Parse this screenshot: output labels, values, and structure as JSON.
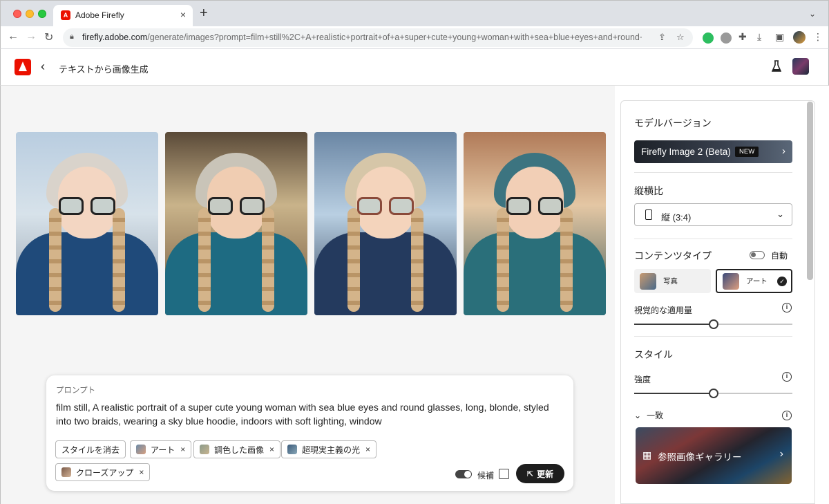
{
  "browser": {
    "tab_title": "Adobe Firefly",
    "url_host": "firefly.adobe.com",
    "url_path": "/generate/images?prompt=film+still%2C+A+realistic+portrait+of+a+super+cute+young+woman+with+sea+blue+eyes+and+round+..."
  },
  "header": {
    "title": "テキストから画像生成"
  },
  "prompt": {
    "label": "プロンプト",
    "text": "film still, A realistic portrait of a super cute young woman with sea blue eyes and round glasses, long, blonde, styled into two braids, wearing a sky blue hoodie, indoors with soft lighting, window",
    "clear_style": "スタイルを消去",
    "chips": [
      "アート",
      "調色した画像",
      "超現実主義の光",
      "クローズアップ"
    ],
    "candidates_label": "候補",
    "update_label": "更新"
  },
  "panel": {
    "model_title": "モデルバージョン",
    "model_value": "Firefly Image 2 (Beta)",
    "model_badge": "NEW",
    "aspect_title": "縦横比",
    "aspect_value": "縦 (3:4)",
    "content_type_title": "コンテンツタイプ",
    "auto_label": "自動",
    "content_photo": "写真",
    "content_art": "アート",
    "visual_intensity_label": "視覚的な適用量",
    "visual_intensity_value": 0.5,
    "style_title": "スタイル",
    "strength_label": "強度",
    "strength_value": 0.5,
    "match_label": "一致",
    "gallery_label": "参照画像ギャラリー"
  },
  "colors": {
    "adobe_red": "#eb1000",
    "update_button": "#1e1e1e"
  }
}
